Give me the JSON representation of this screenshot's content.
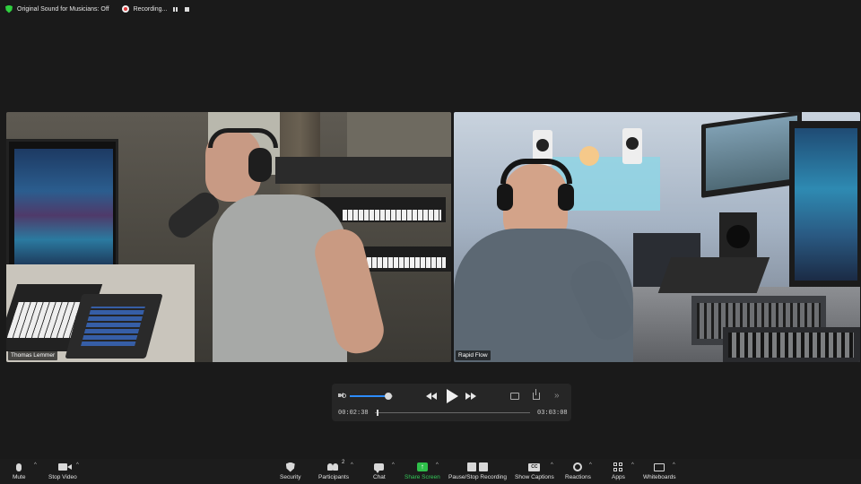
{
  "topbar": {
    "audio_status": "Original Sound for Musicians: Off",
    "recording_label": "Recording..."
  },
  "participants": [
    {
      "name": "Thomas Lemmer"
    },
    {
      "name": "Rapid Flow"
    }
  ],
  "player": {
    "current_time": "00:02:38",
    "total_time": "03:03:08",
    "volume_fraction": 0.9,
    "progress_fraction": 0.014
  },
  "toolbar": {
    "mute": "Mute",
    "stop_video": "Stop Video",
    "security": "Security",
    "participants": "Participants",
    "participants_count": "2",
    "chat": "Chat",
    "share_screen": "Share Screen",
    "pause_stop_recording": "Pause/Stop Recording",
    "show_captions": "Show Captions",
    "captions_icon_text": "CC",
    "reactions": "Reactions",
    "apps": "Apps",
    "whiteboards": "Whiteboards"
  },
  "colors": {
    "security_green": "#2fcf3f",
    "share_green": "#35c759",
    "recording_red": "#e0393a",
    "volume_blue": "#2d8cff"
  }
}
